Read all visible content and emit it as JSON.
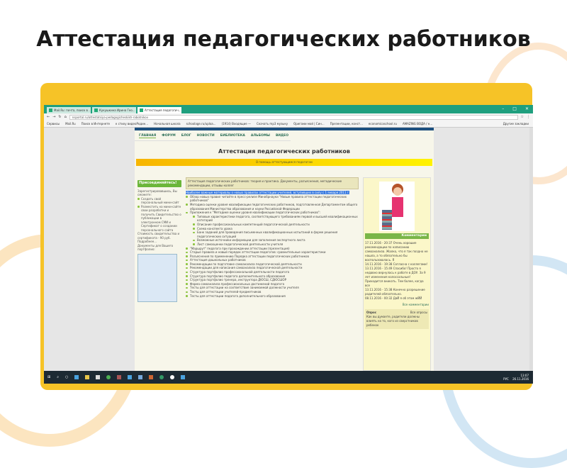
{
  "slide": {
    "title": "Аттестация педагогических работников"
  },
  "browser": {
    "tabs": [
      "Mail.Ru: почта, поиск в ...",
      "Кукушкина Ирина Гео...",
      "Аттестация педагогич..."
    ],
    "url": "nsportal.ru/attestatsiya-pedagogicheskikh-rabotnikov",
    "bookmarks": [
      "Сервисы",
      "Mail.Ru",
      "Поиск в Интернете",
      "к стиху видеоРодин...",
      "Начальная школа",
      "schoolage.ru/uploa...",
      "(1914) Входящие —",
      "Скачать mp3 музыку",
      "Оригами мой | Син...",
      "Презентации, конст...",
      "economicaschool.ru",
      "AMAZING ВОДА / н...",
      "Другие закладки"
    ]
  },
  "page": {
    "nav": [
      "ГЛАВНАЯ",
      "ФОРУМ",
      "БЛОГ",
      "НОВОСТИ",
      "БИБЛИОТЕКА",
      "АЛЬБОМЫ",
      "ВИДЕО"
    ],
    "title": "Аттестация педагогических работников",
    "banner": "В помощь аттестующимся педагогам",
    "left": {
      "join": "Присоединяйтесь!",
      "intro": "Зарегистрировавшись, Вы сможете:",
      "items": [
        "Создать свой персональный мини-сайт",
        "Разместить на мини-сайте свои разработки и получить Свидетельство о публикации в электронном СМИ и Сертификат о создании персонального сайта"
      ],
      "cost": "Стоимость свидетельства и сертификата - 90 руб. Подробнее...",
      "docs": "Документы для Вашего портфолио:"
    },
    "intro": "Аттестация педагогических работников: теория и практика. Документы, разъяснения, методические рекомендации, отзывы коллег",
    "highlight": "Наиболее важные материалы о новых правилах аттестации учителей, вступивших в силу с 1 января 2011 г.",
    "items": [
      "Обзор новых правил читайте в пресс-релизе Минобрнауки \"Новые правила аттестации педагогических работников\"",
      "Методика оценки уровня квалификации педагогических работников, подготовленная Департаментом общего образования Министерства образования и науки Российской Федерации",
      "Приложения к \"Методике оценки уровня квалификации педагогических работников\":"
    ],
    "subitems": [
      "Типовые характеристики педагога, соответствующего требованиям первой и высшей квалификационных категорий",
      "Описание профессиональных компетенций педагогической деятельности",
      "Схема конспекта урока",
      "Банк заданий для проведения письменных квалификационных испытаний в форме решения педагогических ситуаций",
      "Возможные источники информации для заполнения экспертного листа",
      "Лист самооценки педагогической деятельности учителя"
    ],
    "items2": [
      "\"Маршрут\" педагога при прохождении аттестации (презентация)",
      "Старые правила и новый порядок аттестации педагогов: сравнительные характеристики",
      "Разъяснения по применению Порядка аттестации педагогических работников",
      "Аттестация дошкольных работников",
      "Рекомендации по подготовке самоанализа педагогической деятельности",
      "Рекомендации для написания самоанализа педагогической деятельности",
      "Структура портфолио профессиональной деятельности педагога",
      "Структура портфолио педагога дополнительного образования",
      "Структура портфолио тренера, инструктора ДЮСШ, СДЮСШОР",
      "Форма самоанализа профессиональных достижений педагога",
      "Тесты для аттестации на соответствие занимаемой должности учителя",
      "Тесты для аттестации учителей-предметников",
      "Тесты для аттестации педагога дополнительного образования"
    ],
    "right": {
      "comments_title": "Комментарии",
      "comments": [
        "17.11.2016 - 20:37 Очень хорошие рекомендации по написанию самоанализа. Жалко, что я так поздно не нашла, а то обязательно бы воспользовалась. Я",
        "14.11.2016 - 19:38 Согласна с коллегами!",
        "13.11.2016 - 15:49 Спасибо! Просто я недавно вернулась к работе в ДОУ. За 9 лет изменения колоссальные! Приходится вникать. Тем более, когда все",
        "13.11.2016 - 15:38 Конечно разрешение родителей обязательно.",
        "08.11.2016 - 00:32 ДаЙ я об этом жЙЙ"
      ],
      "all_comments": "Все комментарии",
      "poll_title": "Опрос",
      "all_polls": "Все опросы",
      "poll_question": "Как вы думаете, родители должны влиять на то, кого из сверстников ребенок"
    }
  },
  "taskbar": {
    "lang": "РУС",
    "time": "13:07",
    "date": "26.11.2016"
  }
}
